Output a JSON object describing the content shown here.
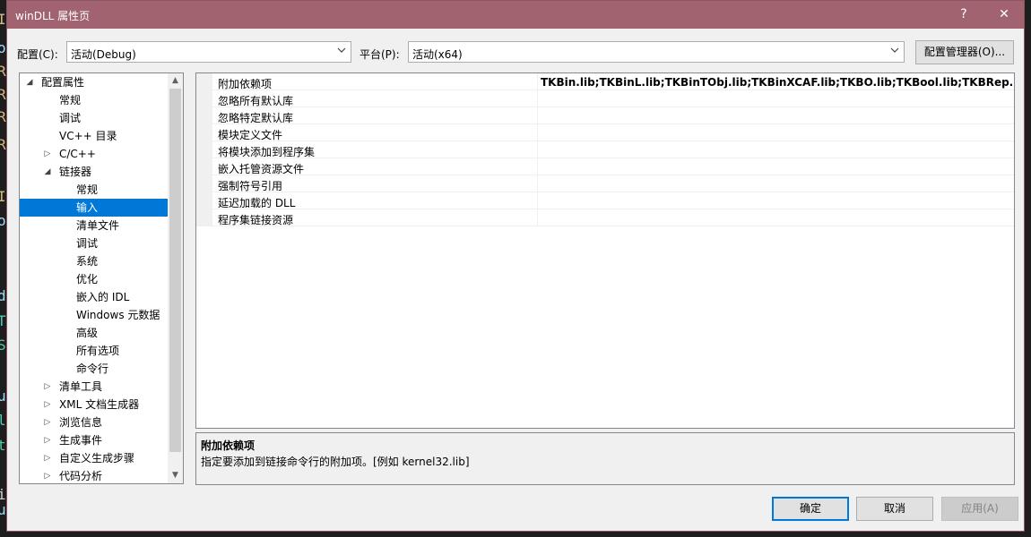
{
  "background_code_fragments": [
    {
      "text": "I",
      "color": "#d7ba7d"
    },
    {
      "text": "o",
      "color": "#9cdcfe"
    },
    {
      "text": "R",
      "color": "#d7ba7d"
    },
    {
      "text": "R",
      "color": "#d7ba7d"
    },
    {
      "text": "R",
      "color": "#d7ba7d"
    },
    {
      "text": "R",
      "color": "#d7ba7d"
    },
    {
      "text": "I",
      "color": "#d7ba7d"
    },
    {
      "text": "o",
      "color": "#9cdcfe"
    },
    {
      "text": "d",
      "color": "#9cdcfe"
    },
    {
      "text": "T",
      "color": "#4ec9b0"
    },
    {
      "text": "S",
      "color": "#4ec9b0"
    },
    {
      "text": "u",
      "color": "#9cdcfe"
    },
    {
      "text": "l",
      "color": "#4ec9b0"
    },
    {
      "text": "t",
      "color": "#4ec9b0"
    },
    {
      "text": "i",
      "color": "#d4d4d4"
    },
    {
      "text": "u",
      "color": "#9cdcfe"
    }
  ],
  "window": {
    "title": "winDLL 属性页",
    "help_label": "?",
    "close_label": "✕"
  },
  "toolbar": {
    "config_label": "配置(C):",
    "config_value": "活动(Debug)",
    "platform_label": "平台(P):",
    "platform_value": "活动(x64)",
    "config_manager_label": "配置管理器(O)..."
  },
  "tree": {
    "items": [
      {
        "label": "配置属性",
        "level": 0,
        "expander": "expanded"
      },
      {
        "label": "常规",
        "level": 1,
        "expander": "none"
      },
      {
        "label": "调试",
        "level": 1,
        "expander": "none"
      },
      {
        "label": "VC++ 目录",
        "level": 1,
        "expander": "none"
      },
      {
        "label": "C/C++",
        "level": 1,
        "expander": "collapsed"
      },
      {
        "label": "链接器",
        "level": 1,
        "expander": "expanded"
      },
      {
        "label": "常规",
        "level": 2,
        "expander": "none"
      },
      {
        "label": "输入",
        "level": 2,
        "expander": "none",
        "selected": true
      },
      {
        "label": "清单文件",
        "level": 2,
        "expander": "none"
      },
      {
        "label": "调试",
        "level": 2,
        "expander": "none"
      },
      {
        "label": "系统",
        "level": 2,
        "expander": "none"
      },
      {
        "label": "优化",
        "level": 2,
        "expander": "none"
      },
      {
        "label": "嵌入的 IDL",
        "level": 2,
        "expander": "none"
      },
      {
        "label": "Windows 元数据",
        "level": 2,
        "expander": "none"
      },
      {
        "label": "高级",
        "level": 2,
        "expander": "none"
      },
      {
        "label": "所有选项",
        "level": 2,
        "expander": "none"
      },
      {
        "label": "命令行",
        "level": 2,
        "expander": "none"
      },
      {
        "label": "清单工具",
        "level": 1,
        "expander": "collapsed"
      },
      {
        "label": "XML 文档生成器",
        "level": 1,
        "expander": "collapsed"
      },
      {
        "label": "浏览信息",
        "level": 1,
        "expander": "collapsed"
      },
      {
        "label": "生成事件",
        "level": 1,
        "expander": "collapsed"
      },
      {
        "label": "自定义生成步骤",
        "level": 1,
        "expander": "collapsed"
      },
      {
        "label": "代码分析",
        "level": 1,
        "expander": "collapsed"
      }
    ]
  },
  "properties": {
    "rows": [
      {
        "name": "附加依赖项",
        "value": "TKBin.lib;TKBinL.lib;TKBinTObj.lib;TKBinXCAF.lib;TKBO.lib;TKBool.lib;TKBRep.lib;TKCAF"
      },
      {
        "name": "忽略所有默认库",
        "value": ""
      },
      {
        "name": "忽略特定默认库",
        "value": ""
      },
      {
        "name": "模块定义文件",
        "value": ""
      },
      {
        "name": "将模块添加到程序集",
        "value": ""
      },
      {
        "name": "嵌入托管资源文件",
        "value": ""
      },
      {
        "name": "强制符号引用",
        "value": ""
      },
      {
        "name": "延迟加载的 DLL",
        "value": ""
      },
      {
        "name": "程序集链接资源",
        "value": ""
      }
    ]
  },
  "description": {
    "title": "附加依赖项",
    "text": "指定要添加到链接命令行的附加项。[例如 kernel32.lib]"
  },
  "buttons": {
    "ok": "确定",
    "cancel": "取消",
    "apply": "应用(A)"
  },
  "colors": {
    "titlebar": "#a0636f",
    "selection": "#0078d7"
  }
}
